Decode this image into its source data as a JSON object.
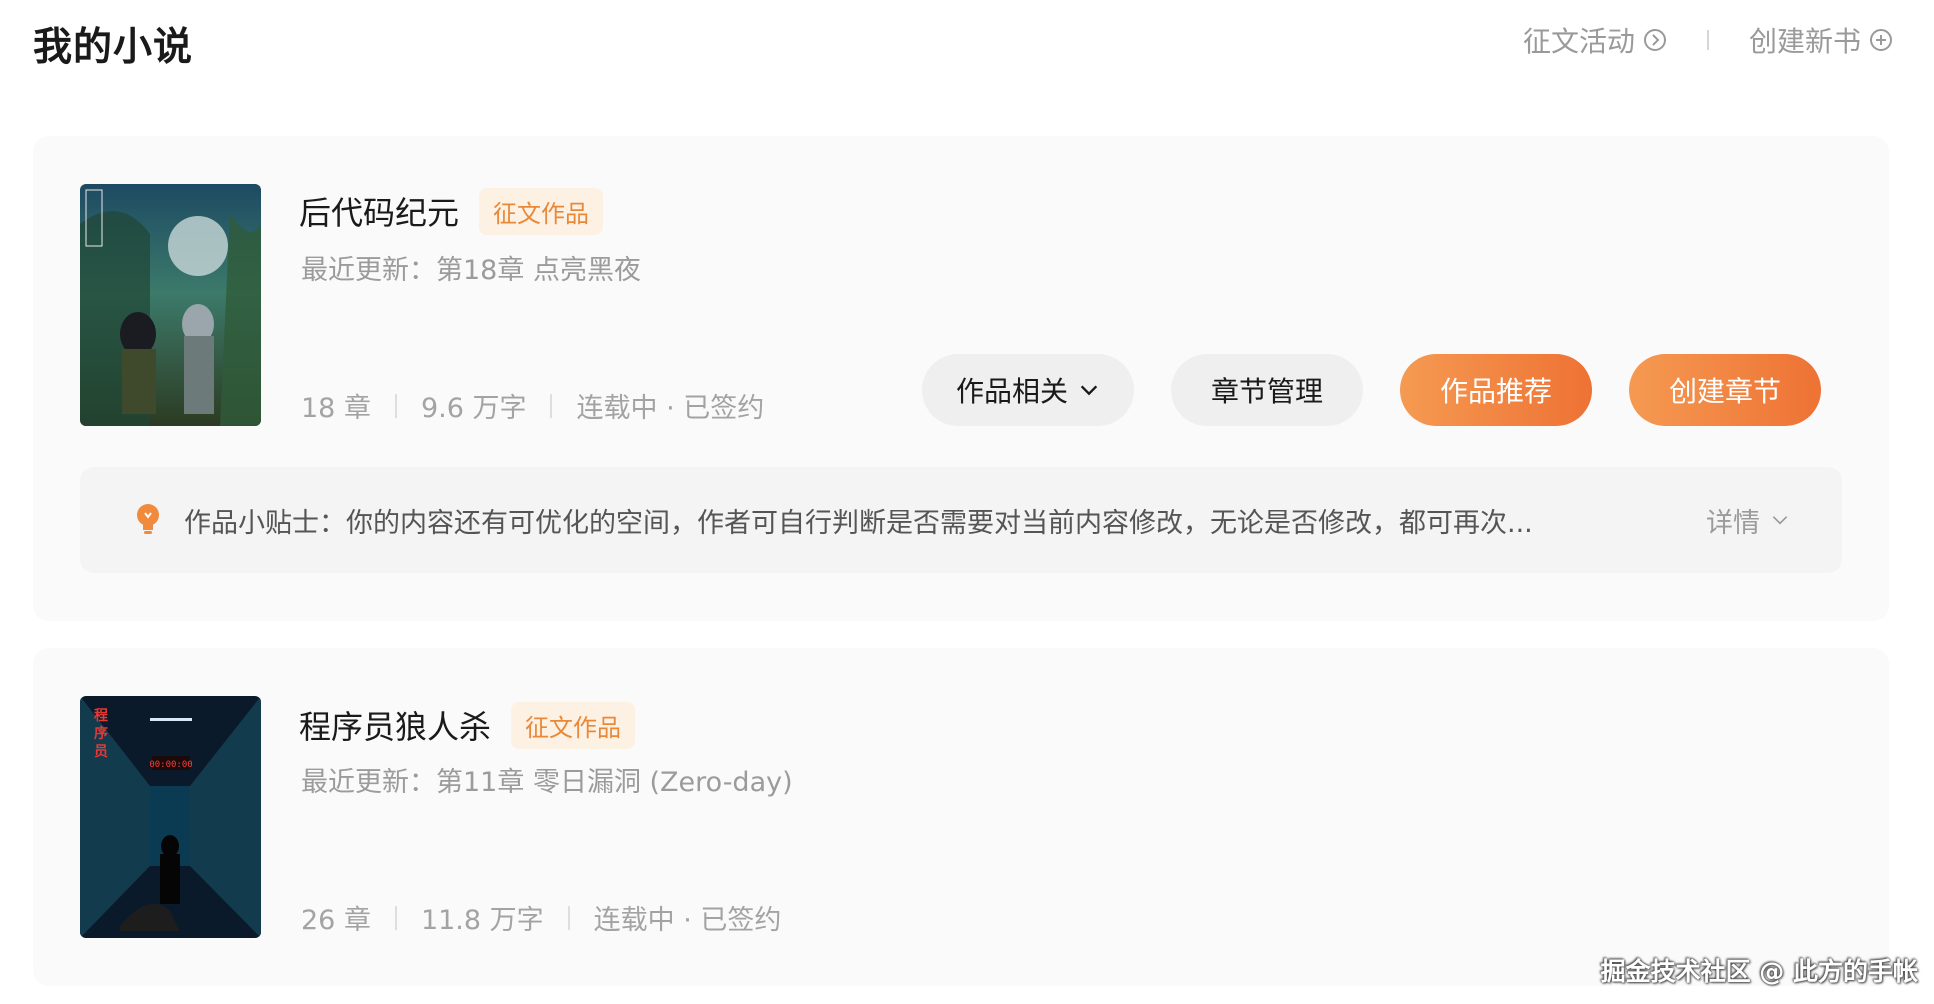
{
  "header": {
    "title": "我的小说",
    "contest_label": "征文活动",
    "create_book_label": "创建新书"
  },
  "novels": [
    {
      "title": "后代码纪元",
      "tag": "征文作品",
      "latest": "最近更新：第18章 点亮黑夜",
      "chapters": "18 章",
      "words": "9.6 万字",
      "status": "连载中 · 已签约",
      "actions": {
        "related": "作品相关",
        "manage": "章节管理",
        "recommend": "作品推荐",
        "create": "创建章节"
      },
      "tip": {
        "text": "作品小贴士：你的内容还有可优化的空间，作者可自行判断是否需要对当前内容修改，无论是否修改，都可再次...",
        "detail": "详情"
      }
    },
    {
      "title": "程序员狼人杀",
      "tag": "征文作品",
      "latest": "最近更新：第11章 零日漏洞 (Zero-day)",
      "chapters": "26 章",
      "words": "11.8 万字",
      "status": "连载中 · 已签约"
    }
  ],
  "watermark": "掘金技术社区 @ 此方的手帐",
  "colors": {
    "accent": "#ee7234",
    "tag_text": "#e8893a",
    "tag_bg": "#fdf1e4"
  },
  "icons": [
    "chevron-circle-icon",
    "plus-circle-icon",
    "chevron-down-icon",
    "lightbulb-icon"
  ]
}
